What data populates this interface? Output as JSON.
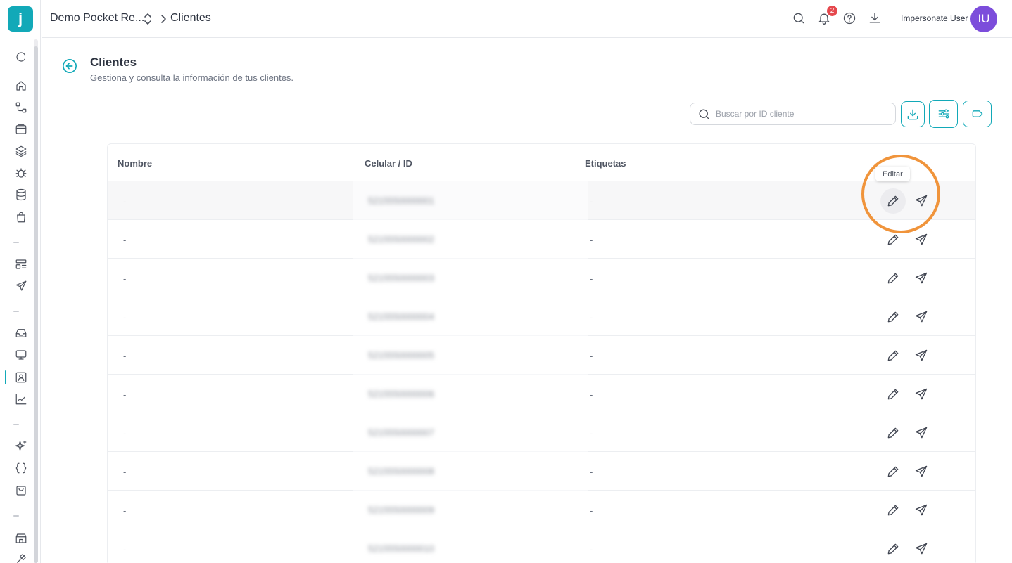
{
  "app": {
    "logo_letter": "j"
  },
  "header": {
    "workspace_name": "Demo Pocket Re...",
    "breadcrumb_current": "Clientes",
    "notification_count": "2",
    "user_name": "Impersonate User",
    "user_initials": "IU"
  },
  "sidebar": {
    "items": [
      {
        "icon": "refresh-icon"
      },
      {
        "icon": "home-icon"
      },
      {
        "icon": "flow-icon"
      },
      {
        "icon": "archive-icon"
      },
      {
        "icon": "layers-icon"
      },
      {
        "icon": "bug-icon"
      },
      {
        "icon": "database-icon"
      },
      {
        "icon": "shopping-bag-icon"
      },
      {
        "icon": "layout-list-icon"
      },
      {
        "icon": "send-icon"
      },
      {
        "icon": "inbox-icon"
      },
      {
        "icon": "monitor-icon"
      },
      {
        "icon": "contact-icon",
        "active": true
      },
      {
        "icon": "chart-icon"
      },
      {
        "icon": "sparkles-icon"
      },
      {
        "icon": "braces-icon"
      },
      {
        "icon": "package-icon"
      },
      {
        "icon": "store-icon"
      },
      {
        "icon": "plug-icon"
      }
    ]
  },
  "page": {
    "title": "Clientes",
    "subtitle": "Gestiona y consulta la información de tus clientes."
  },
  "toolbar": {
    "search_placeholder": "Buscar por ID cliente"
  },
  "table": {
    "columns": [
      "Nombre",
      "Celular / ID",
      "Etiquetas"
    ],
    "rows": [
      {
        "nombre": "-",
        "celular": "5215550000001",
        "etiquetas": "-"
      },
      {
        "nombre": "-",
        "celular": "5215550000002",
        "etiquetas": "-"
      },
      {
        "nombre": "-",
        "celular": "5215550000003",
        "etiquetas": "-"
      },
      {
        "nombre": "-",
        "celular": "5215550000004",
        "etiquetas": "-"
      },
      {
        "nombre": "-",
        "celular": "5215550000005",
        "etiquetas": "-"
      },
      {
        "nombre": "-",
        "celular": "5215550000006",
        "etiquetas": "-"
      },
      {
        "nombre": "-",
        "celular": "5215550000007",
        "etiquetas": "-"
      },
      {
        "nombre": "-",
        "celular": "5215550000008",
        "etiquetas": "-"
      },
      {
        "nombre": "-",
        "celular": "5215550000009",
        "etiquetas": "-"
      },
      {
        "nombre": "-",
        "celular": "5215550000010",
        "etiquetas": "-"
      }
    ],
    "edit_tooltip": "Editar"
  },
  "colors": {
    "accent": "#12a9b8",
    "avatar": "#7c4ddb",
    "badge": "#e5484d",
    "highlight": "#f0943b"
  }
}
